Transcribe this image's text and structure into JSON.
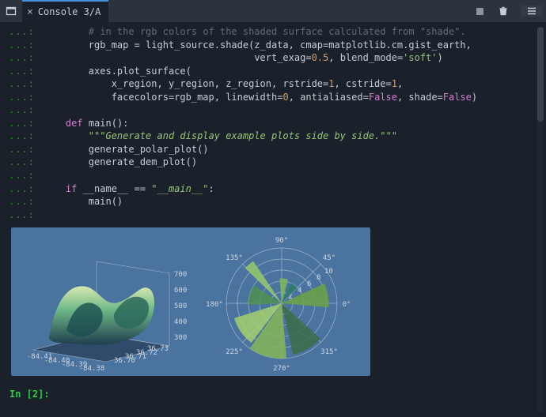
{
  "tab": {
    "title": "Console 3/A"
  },
  "code": {
    "l0": "# in the rgb colors of the shaded surface calculated from \"shade\".",
    "l1a": "rgb_map = light_source.shade(z_data, cmap=matplotlib.cm.gist_earth,",
    "l2a": "vert_exag=",
    "l2n1": "0.5",
    "l2b": ", blend_mode=",
    "l2s": "'soft'",
    "l2c": ")",
    "l3": "axes.plot_surface(",
    "l4a": "x_region, y_region, z_region, rstride=",
    "l4n1": "1",
    "l4b": ", cstride=",
    "l4n2": "1",
    "l4c": ",",
    "l5a": "facecolors=rgb_map, linewidth=",
    "l5n1": "0",
    "l5b": ", antialiased=",
    "l5k1": "False",
    "l5c": ", shade=",
    "l5k2": "False",
    "l5d": ")",
    "l7a": "def",
    "l7b": " main():",
    "l8": "\"\"\"Generate and display example plots side by side.\"\"\"",
    "l9": "generate_polar_plot()",
    "l10": "generate_dem_plot()",
    "l12a": "if",
    "l12b": " __name__ == ",
    "l12s": "\"__main__\"",
    "l12c": ":",
    "l13": "main()"
  },
  "prompt": {
    "label": "In [2]:"
  },
  "chart_data": [
    {
      "type": "3d-surface",
      "title": "",
      "x_ticks": [
        "-84.41",
        "-84.40",
        "-84.39",
        "-84.38"
      ],
      "y_ticks": [
        "36.70",
        "36.71",
        "36.72",
        "36.73"
      ],
      "z_ticks": [
        "300",
        "400",
        "500",
        "600",
        "700"
      ],
      "xlabel": "",
      "ylabel": "",
      "zlabel": "",
      "note": "DEM surface shaded with gist_earth colormap; values are axis tick labels visible in plot."
    },
    {
      "type": "polar-bar",
      "title": "",
      "angle_ticks_deg": [
        0,
        45,
        90,
        135,
        180,
        225,
        270,
        315
      ],
      "angle_tick_labels": [
        "0°",
        "45°",
        "90°",
        "135°",
        "180°",
        "225°",
        "270°",
        "315°"
      ],
      "radial_ticks": [
        2,
        4,
        6,
        8,
        10
      ],
      "bars": [
        {
          "center_deg": 10,
          "width_deg": 30,
          "radius": 8.5,
          "color": "#6aa244"
        },
        {
          "center_deg": 55,
          "width_deg": 20,
          "radius": 4.0,
          "color": "#2f7a63"
        },
        {
          "center_deg": 85,
          "width_deg": 20,
          "radius": 4.5,
          "color": "#7cb85a"
        },
        {
          "center_deg": 130,
          "width_deg": 12,
          "radius": 9.2,
          "color": "#95c96a"
        },
        {
          "center_deg": 165,
          "width_deg": 35,
          "radius": 6.0,
          "color": "#4f9150"
        },
        {
          "center_deg": 215,
          "width_deg": 35,
          "radius": 9.0,
          "color": "#a4d06e"
        },
        {
          "center_deg": 255,
          "width_deg": 40,
          "radius": 10.0,
          "color": "#85b557"
        },
        {
          "center_deg": 300,
          "width_deg": 35,
          "radius": 9.5,
          "color": "#3a6d47"
        }
      ],
      "r_max": 10
    }
  ],
  "surface_labels": {
    "z": [
      "700",
      "600",
      "500",
      "400",
      "300"
    ],
    "y": [
      "36.73",
      "36.72",
      "36.71",
      "36.70"
    ],
    "x": [
      "-84.41",
      "-84.40",
      "-84.39",
      "-84.38"
    ]
  },
  "polar_labels": {
    "angles": [
      "0°",
      "45°",
      "90°",
      "135°",
      "180°",
      "225°",
      "270°",
      "315°"
    ],
    "radii": [
      "2",
      "4",
      "6",
      "8",
      "10"
    ]
  }
}
